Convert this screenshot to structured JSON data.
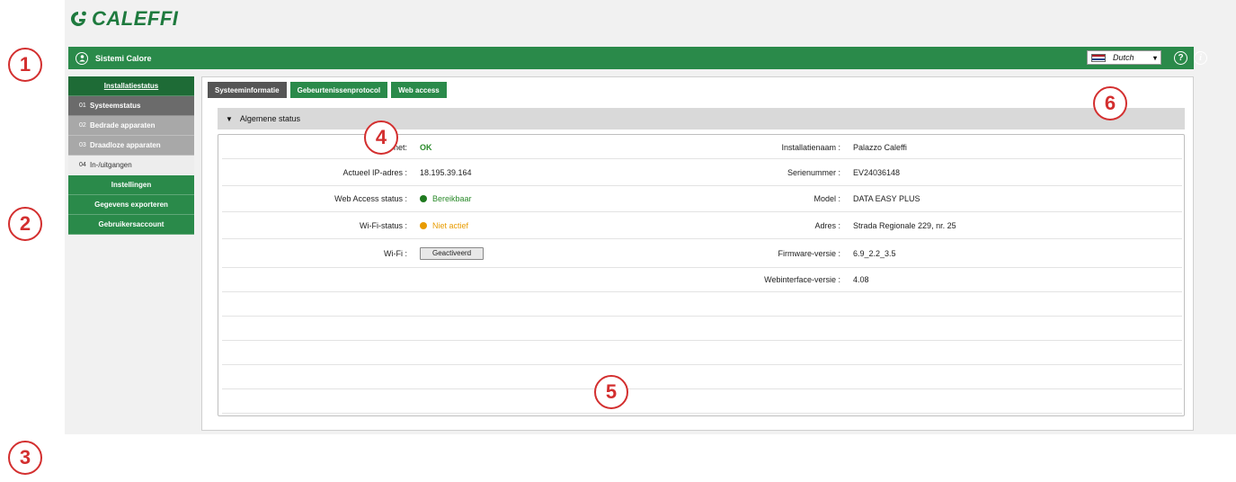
{
  "brand": {
    "logo_text": "CALEFFI",
    "color": "#1e7a3e"
  },
  "topbar": {
    "user_name": "Sistemi Calore",
    "user_icon": "user-circle-icon",
    "language": "Dutch",
    "help_icon": "help-icon",
    "info_icon": "info-icon",
    "accent": "#2a8a4a"
  },
  "sidebar": {
    "items": [
      {
        "num": "",
        "label": "Installatiestatus"
      },
      {
        "num": "01",
        "label": "Systeemstatus"
      },
      {
        "num": "02",
        "label": "Bedrade apparaten"
      },
      {
        "num": "03",
        "label": "Draadloze apparaten"
      },
      {
        "num": "04",
        "label": "In-/uitgangen"
      },
      {
        "num": "",
        "label": "Instellingen"
      },
      {
        "num": "",
        "label": "Gegevens exporteren"
      },
      {
        "num": "",
        "label": "Gebruikersaccount"
      }
    ]
  },
  "tabs": [
    {
      "label": "Systeeminformatie"
    },
    {
      "label": "Gebeurtenissenprotocol"
    },
    {
      "label": "Web access"
    }
  ],
  "section": {
    "title": "Algemene status",
    "toggle": "▼"
  },
  "status": {
    "left": [
      {
        "label": "Internet:",
        "value": "OK"
      },
      {
        "label": "Actueel IP-adres :",
        "value": "18.195.39.164"
      },
      {
        "label": "Web Access status :",
        "value": "Bereikbaar"
      },
      {
        "label": "Wi-Fi-status :",
        "value": "Niet actief"
      },
      {
        "label": "Wi-Fi :",
        "value": "Geactiveerd"
      }
    ],
    "right": [
      {
        "label": "Installatienaam :",
        "value": "Palazzo Caleffi"
      },
      {
        "label": "Serienummer :",
        "value": "EV24036148"
      },
      {
        "label": "Model :",
        "value": "DATA EASY PLUS"
      },
      {
        "label": "Adres :",
        "value": "Strada Regionale 229, nr. 25"
      },
      {
        "label": "Firmware-versie :",
        "value": "6.9_2.2_3.5"
      },
      {
        "label": "Webinterface-versie :",
        "value": "4.08"
      }
    ],
    "colors": {
      "ok": "#2a8a2a",
      "reachable_dot": "#1f7a1f",
      "inactive": "#e89b00"
    }
  },
  "markers": [
    "1",
    "2",
    "3",
    "4",
    "5",
    "6"
  ]
}
